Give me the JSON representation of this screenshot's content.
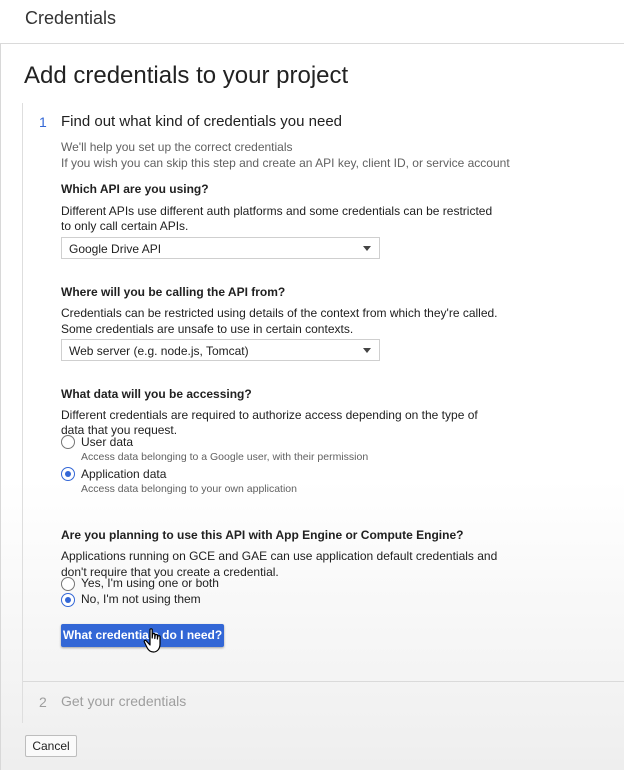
{
  "header": {
    "title": "Credentials"
  },
  "page": {
    "title": "Add credentials to your project"
  },
  "step1": {
    "number": "1",
    "title": "Find out what kind of credentials you need",
    "intro_line1": "We'll help you set up the correct credentials",
    "intro_line2": "If you wish you can skip this step and create an API key, client ID, or service account"
  },
  "api_question": {
    "label": "Which API are you using?",
    "desc_line1": "Different APIs use different auth platforms and some credentials can be restricted",
    "desc_line2": "to only call certain APIs.",
    "selected": "Google Drive API"
  },
  "calling_question": {
    "label": "Where will you be calling the API from?",
    "desc_line1": "Credentials can be restricted using details of the context from which they're called.",
    "desc_line2": "Some credentials are unsafe to use in certain contexts.",
    "selected": "Web server (e.g. node.js, Tomcat)"
  },
  "data_question": {
    "label": "What data will you be accessing?",
    "desc_line1": "Different credentials are required to authorize access depending on the type of",
    "desc_line2": "data that you request.",
    "options": [
      {
        "label": "User data",
        "help": "Access data belonging to a Google user, with their permission",
        "checked": false
      },
      {
        "label": "Application data",
        "help": "Access data belonging to your own application",
        "checked": true
      }
    ]
  },
  "engine_question": {
    "label": "Are you planning to use this API with App Engine or Compute Engine?",
    "desc_line1": "Applications running on GCE and GAE can use application default credentials and",
    "desc_line2": "don't require that you create a credential.",
    "options": [
      {
        "label": "Yes, I'm using one or both",
        "checked": false
      },
      {
        "label": "No, I'm not using them",
        "checked": true
      }
    ]
  },
  "actions": {
    "primary_label": "What credentials do I need?",
    "cancel_label": "Cancel"
  },
  "step2": {
    "number": "2",
    "title": "Get your credentials"
  },
  "colors": {
    "accent": "#3367d6",
    "text": "#212121",
    "muted": "#616161"
  },
  "icons": {
    "select_caret": "caret-down-icon",
    "pointer": "hand-pointer-icon"
  }
}
